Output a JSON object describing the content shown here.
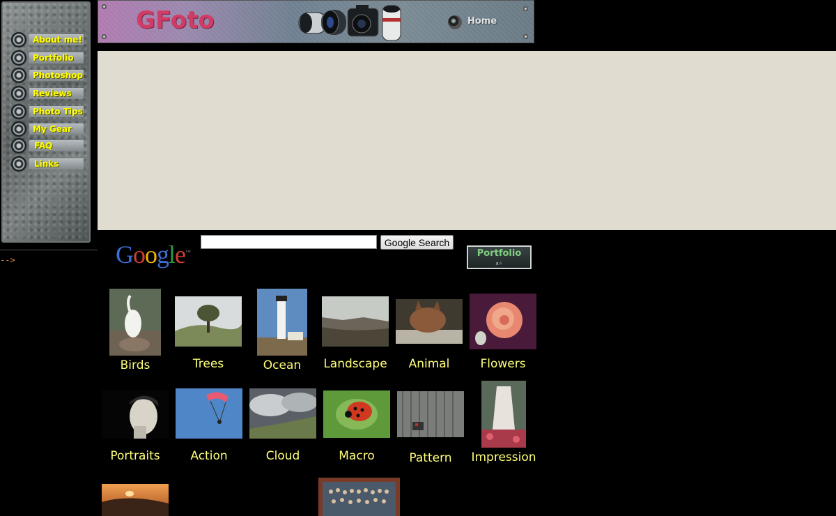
{
  "site": {
    "logo": "GFoto",
    "home_label": "Home"
  },
  "sidebar": {
    "items": [
      {
        "label": "About me!"
      },
      {
        "label": "Portfolio"
      },
      {
        "label": "Photoshop"
      },
      {
        "label": "Reviews"
      },
      {
        "label": "Photo Tips"
      },
      {
        "label": "My Gear"
      },
      {
        "label": "FAQ"
      },
      {
        "label": "Links"
      }
    ]
  },
  "stray_text": "-->",
  "search": {
    "logo_letters": [
      "G",
      "o",
      "o",
      "g",
      "l",
      "e"
    ],
    "button_label": "Google Search",
    "input_value": ""
  },
  "portfolio_badge": {
    "label": "Portfolio",
    "sub": "ᴥ✧"
  },
  "gallery": {
    "captions": [
      "Birds",
      "Trees",
      "Ocean",
      "Landscape",
      "Animal",
      "Flowers",
      "Portraits",
      "Action",
      "Cloud",
      "Macro",
      "Pattern",
      "Impression"
    ]
  },
  "colors": {
    "accent_yellow": "#ffff00",
    "caption_yellow": "#ffff7a",
    "logo_pink": "#d13c66",
    "panel_beige": "#e0dcd0",
    "google": [
      "#3b6fd8",
      "#d23f31",
      "#f0b400",
      "#3b6fd8",
      "#2e9b44",
      "#d23f31"
    ]
  }
}
